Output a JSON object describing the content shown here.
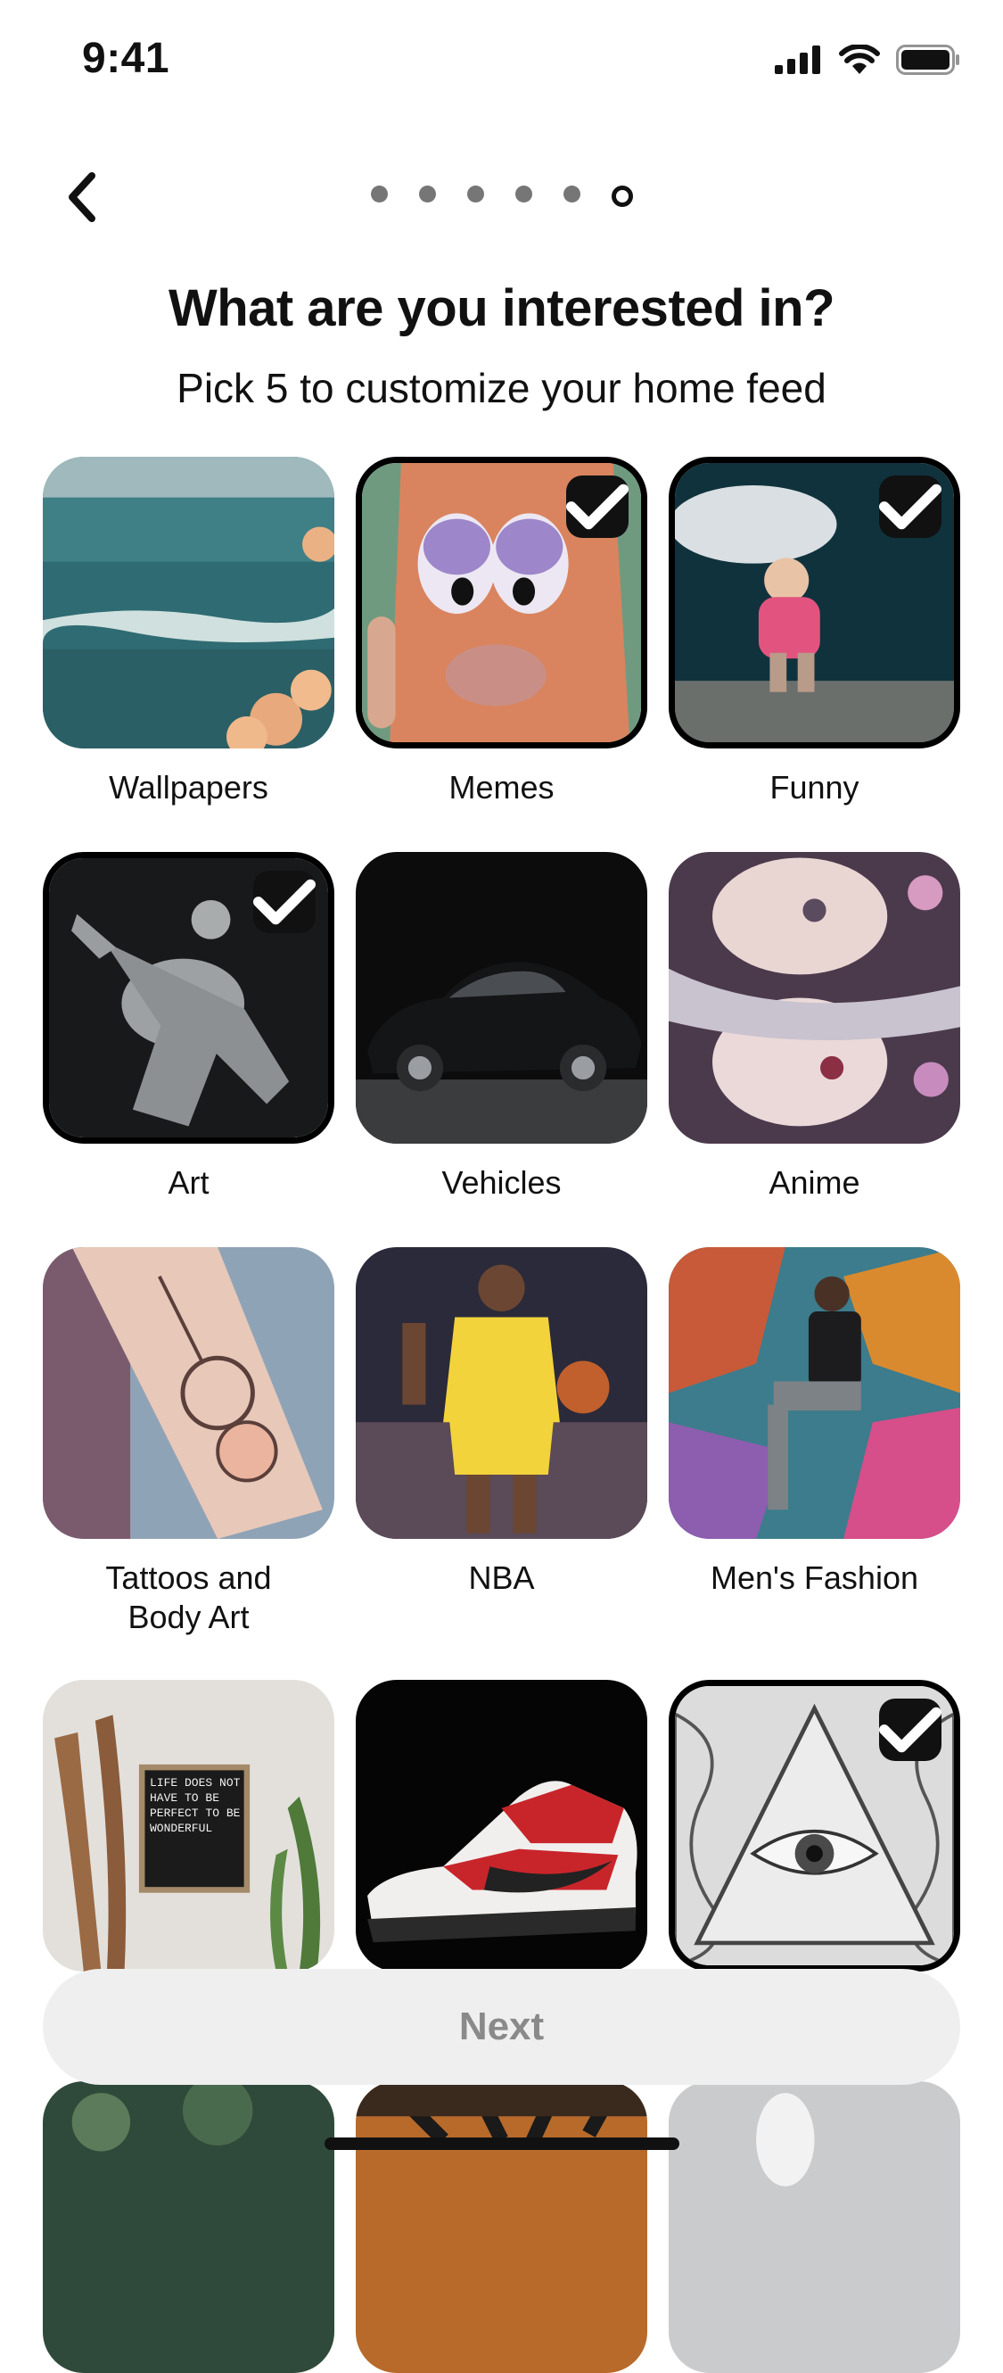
{
  "status_bar": {
    "time": "9:41"
  },
  "nav": {
    "progress_total": 6,
    "progress_current": 6
  },
  "header": {
    "title": "What are you interested in?",
    "subtitle": "Pick 5 to customize your home feed"
  },
  "topics": [
    {
      "label": "Wallpapers",
      "selected": false,
      "image": "ocean-waves-with-flowers"
    },
    {
      "label": "Memes",
      "selected": true,
      "image": "cartoon-face-with-lips"
    },
    {
      "label": "Funny",
      "selected": true,
      "image": "child-with-beluga-whale"
    },
    {
      "label": "Art",
      "selected": true,
      "image": "marble-statue"
    },
    {
      "label": "Vehicles",
      "selected": false,
      "image": "black-classic-car"
    },
    {
      "label": "Anime",
      "selected": false,
      "image": "anime-girls"
    },
    {
      "label": "Tattoos and Body Art",
      "selected": false,
      "image": "flower-arm-tattoo"
    },
    {
      "label": "NBA",
      "selected": false,
      "image": "basketball-player-lakers"
    },
    {
      "label": "Men's Fashion",
      "selected": false,
      "image": "man-on-graffiti-wall"
    },
    {
      "label": "",
      "selected": false,
      "image": "letter-board-with-plants",
      "board_text": "LIFE DOES NOT HAVE TO BE PERFECT TO BE WONDERFUL"
    },
    {
      "label": "",
      "selected": false,
      "image": "red-sneaker"
    },
    {
      "label": "",
      "selected": true,
      "image": "eye-in-triangle-drawing"
    },
    {
      "label": "",
      "selected": false,
      "image": "green-nature"
    },
    {
      "label": "",
      "selected": false,
      "image": "tiger"
    },
    {
      "label": "",
      "selected": false,
      "image": "white-interior"
    }
  ],
  "next_button": {
    "label": "Next",
    "enabled": false
  },
  "colors": {
    "selected_border": "#000000",
    "next_bg": "#efefef",
    "next_text": "#8a8a8a"
  }
}
